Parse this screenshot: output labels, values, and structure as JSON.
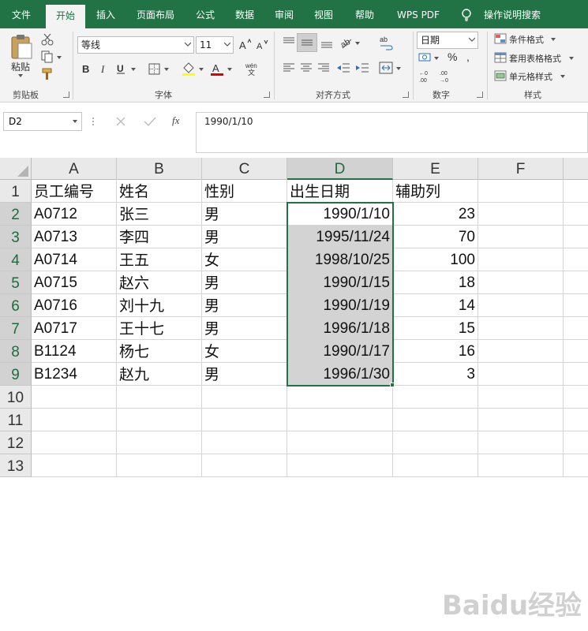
{
  "tabs": [
    "文件",
    "开始",
    "插入",
    "页面布局",
    "公式",
    "数据",
    "审阅",
    "视图",
    "帮助",
    "WPS PDF"
  ],
  "tell_me": "操作说明搜索",
  "clipboard": {
    "paste_label": "粘贴",
    "group": "剪贴板"
  },
  "font": {
    "name": "等线",
    "size": "11",
    "group": "字体"
  },
  "alignment": {
    "group": "对齐方式"
  },
  "number": {
    "format": "日期",
    "percent": "%",
    "group": "数字"
  },
  "styles": {
    "conditional": "条件格式",
    "table_format": "套用表格格式",
    "cell_styles": "单元格样式",
    "group": "样式"
  },
  "formula_bar": {
    "name_box": "D2",
    "fx": "fx",
    "content": "1990/1/10"
  },
  "columns": [
    "A",
    "B",
    "C",
    "D",
    "E",
    "F"
  ],
  "rows": [
    "1",
    "2",
    "3",
    "4",
    "5",
    "6",
    "7",
    "8",
    "9",
    "10",
    "11",
    "12",
    "13"
  ],
  "table": [
    [
      "员工编号",
      "姓名",
      "性别",
      "出生日期",
      "辅助列"
    ],
    [
      "A0712",
      "张三",
      "男",
      "1990/1/10",
      "23"
    ],
    [
      "A0713",
      "李四",
      "男",
      "1995/11/24",
      "70"
    ],
    [
      "A0714",
      "王五",
      "女",
      "1998/10/25",
      "100"
    ],
    [
      "A0715",
      "赵六",
      "男",
      "1990/1/15",
      "18"
    ],
    [
      "A0716",
      "刘十九",
      "男",
      "1990/1/19",
      "14"
    ],
    [
      "A0717",
      "王十七",
      "男",
      "1996/1/18",
      "15"
    ],
    [
      "B1124",
      "杨七",
      "女",
      "1990/1/17",
      "16"
    ],
    [
      "B1234",
      "赵九",
      "男",
      "1996/1/30",
      "3"
    ]
  ],
  "watermark": "Baidu经验",
  "colors": {
    "accent": "#217346",
    "selection_shade": "#d3d3d3"
  }
}
